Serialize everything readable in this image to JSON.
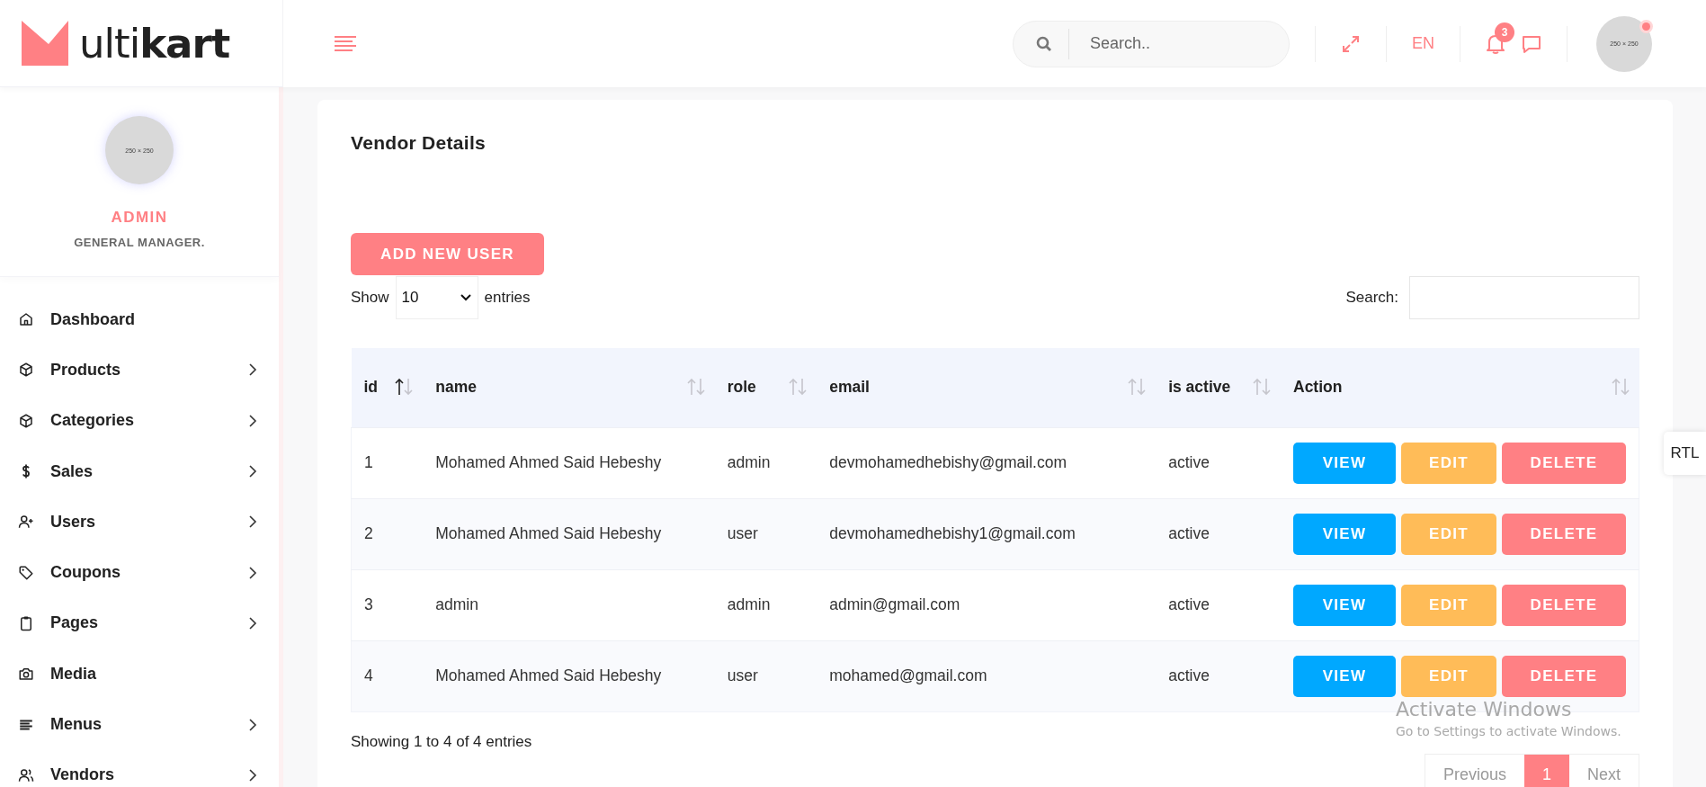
{
  "logo": {
    "text": "ulti**kart**"
  },
  "topbar": {
    "search": {
      "placeholder": "Search.."
    },
    "language": "EN",
    "notifications": {
      "count": "3"
    },
    "avatar": {
      "text": "250 × 250",
      "online": true
    }
  },
  "profile": {
    "avatar_text": "250 × 250",
    "name": "ADMIN",
    "role": "GENERAL MANAGER."
  },
  "sidebar": {
    "items": [
      {
        "label": "Dashboard",
        "submenu": false
      },
      {
        "label": "Products",
        "submenu": true
      },
      {
        "label": "Categories",
        "submenu": true
      },
      {
        "label": "Sales",
        "submenu": true
      },
      {
        "label": "Users",
        "submenu": true
      },
      {
        "label": "Coupons",
        "submenu": true
      },
      {
        "label": "Pages",
        "submenu": true
      },
      {
        "label": "Media",
        "submenu": false
      },
      {
        "label": "Menus",
        "submenu": true
      },
      {
        "label": "Vendors",
        "submenu": true
      }
    ]
  },
  "card": {
    "title": "Vendor Details",
    "add_button": "ADD NEW USER",
    "length": {
      "before": "Show",
      "value": "10",
      "after": "entries"
    },
    "filter": {
      "label": "Search:"
    },
    "table": {
      "columns": [
        {
          "label": "id",
          "sorted": true
        },
        {
          "label": "name",
          "sorted": false
        },
        {
          "label": "role",
          "sorted": false
        },
        {
          "label": "email",
          "sorted": false
        },
        {
          "label": "is active",
          "sorted": false
        },
        {
          "label": "Action",
          "sorted": false
        }
      ],
      "rows": [
        {
          "cells": [
            "1",
            "Mohamed Ahmed Said Hebeshy",
            "admin",
            "devmohamedhebishy@gmail.com",
            "active"
          ],
          "actions": [
            {
              "label": "VIEW",
              "kind": "view"
            },
            {
              "label": "EDIT",
              "kind": "edit"
            },
            {
              "label": "DELETE",
              "kind": "delete"
            }
          ]
        },
        {
          "cells": [
            "2",
            "Mohamed Ahmed Said Hebeshy",
            "user",
            "devmohamedhebishy1@gmail.com",
            "active"
          ],
          "actions": [
            {
              "label": "VIEW",
              "kind": "view"
            },
            {
              "label": "EDIT",
              "kind": "edit"
            },
            {
              "label": "DELETE",
              "kind": "delete"
            }
          ]
        },
        {
          "cells": [
            "3",
            "admin",
            "admin",
            "admin@gmail.com",
            "active"
          ],
          "actions": [
            {
              "label": "VIEW",
              "kind": "view"
            },
            {
              "label": "EDIT",
              "kind": "edit"
            },
            {
              "label": "DELETE",
              "kind": "delete"
            }
          ]
        },
        {
          "cells": [
            "4",
            "Mohamed Ahmed Said Hebeshy",
            "user",
            "mohamed@gmail.com",
            "active"
          ],
          "actions": [
            {
              "label": "VIEW",
              "kind": "view"
            },
            {
              "label": "EDIT",
              "kind": "edit"
            },
            {
              "label": "DELETE",
              "kind": "delete"
            }
          ]
        }
      ]
    },
    "info": "Showing 1 to 4 of 4 entries",
    "pagination": [
      {
        "label": "Previous",
        "selected": false
      },
      {
        "label": "1",
        "selected": true
      },
      {
        "label": "Next",
        "selected": false
      }
    ]
  },
  "rtl_tab": "RTL",
  "os_notice": {
    "title": "Activate Windows",
    "text": "Go to Settings to activate Windows."
  }
}
